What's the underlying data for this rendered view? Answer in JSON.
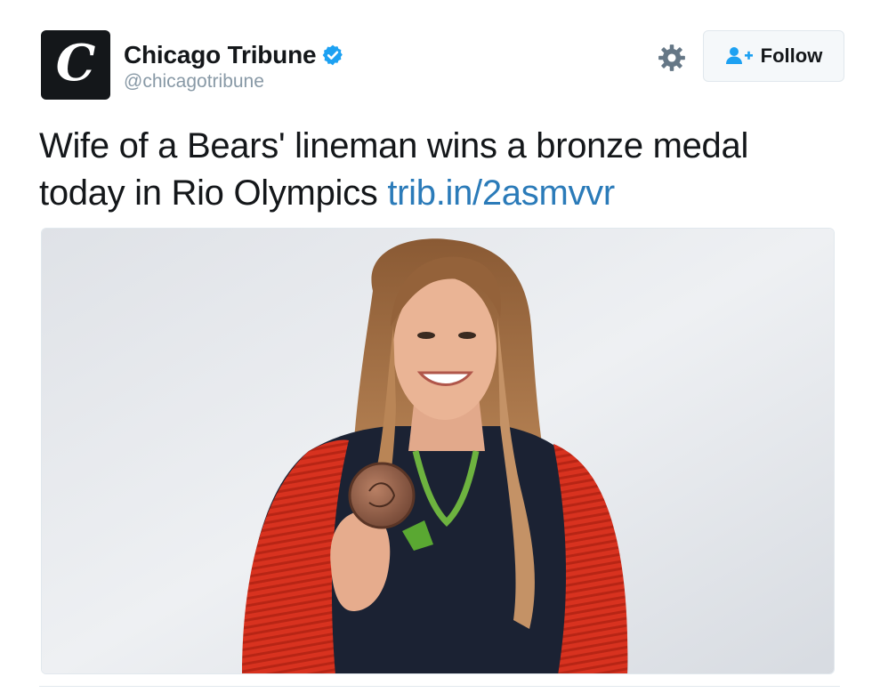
{
  "account": {
    "display_name": "Chicago Tribune",
    "handle": "@chicagotribune",
    "avatar_letter": "C",
    "verified": true
  },
  "actions": {
    "follow_label": "Follow",
    "settings_icon": "gear-icon",
    "follow_icon": "add-user-icon"
  },
  "tweet": {
    "text": "Wife of a Bears' lineman wins a bronze medal today in Rio Olympics",
    "link_text": "trib.in/2asmvvr"
  },
  "colors": {
    "link": "#2b7bb9",
    "verified": "#1da1f2",
    "follow_icon": "#1da1f2",
    "text": "#14171a",
    "muted": "#8899a6"
  }
}
